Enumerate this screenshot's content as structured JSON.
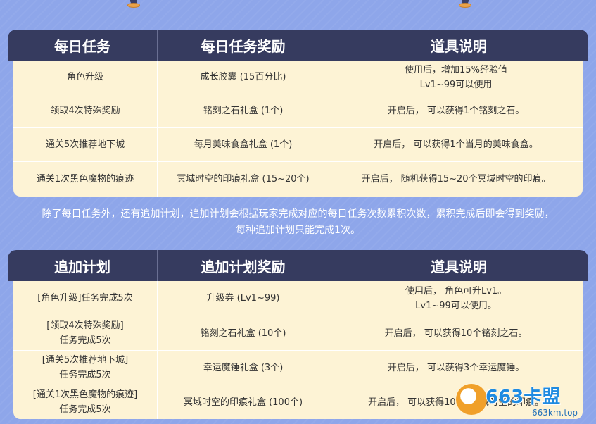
{
  "table1": {
    "headers": [
      "每日任务",
      "每日任务奖励",
      "道具说明"
    ],
    "rows": [
      {
        "task": "角色升级",
        "reward": "成长胶囊 (15百分比)",
        "desc": [
          "使用后，增加15%经验值",
          "Lv1~99可以使用"
        ]
      },
      {
        "task": "领取4次特殊奖励",
        "reward": "铭刻之石礼盒 (1个)",
        "desc": [
          "开启后， 可以获得1个铭刻之石。"
        ]
      },
      {
        "task": "通关5次推荐地下城",
        "reward": "每月美味食盒礼盒 (1个)",
        "desc": [
          "开启后， 可以获得1个当月的美味食盒。"
        ]
      },
      {
        "task": "通关1次黑色魔物的痕迹",
        "reward": "冥域时空的印痕礼盒 (15~20个)",
        "desc": [
          "开启后， 随机获得15~20个冥域时空的印痕。"
        ]
      }
    ]
  },
  "note": {
    "line1": "除了每日任务外，还有追加计划，追加计划会根据玩家完成对应的每日任务次数累积次数，累积完成后即会得到奖励，",
    "line2": "每种追加计划只能完成1次。"
  },
  "table2": {
    "headers": [
      "追加计划",
      "追加计划奖励",
      "道具说明"
    ],
    "rows": [
      {
        "task": [
          "[角色升级]任务完成5次"
        ],
        "reward": "升级券 (Lv1~99)",
        "desc": [
          "使用后， 角色可升Lv1。",
          "Lv1~99可以使用。"
        ]
      },
      {
        "task": [
          "[领取4次特殊奖励]",
          "任务完成5次"
        ],
        "reward": "铭刻之石礼盒 (10个)",
        "desc": [
          "开启后， 可以获得10个铭刻之石。"
        ]
      },
      {
        "task": [
          "[通关5次推荐地下城]",
          "任务完成5次"
        ],
        "reward": "幸运魔锤礼盒 (3个)",
        "desc": [
          "开启后， 可以获得3个幸运魔锤。"
        ]
      },
      {
        "task": [
          "[通关1次黑色魔物的痕迹]",
          "任务完成5次"
        ],
        "reward": "冥域时空的印痕礼盒 (100个)",
        "desc": [
          "开启后， 可以获得100个冥域时空的印痕。"
        ]
      }
    ]
  },
  "watermark": {
    "brand": "663卡盟",
    "url": "663km.top"
  }
}
